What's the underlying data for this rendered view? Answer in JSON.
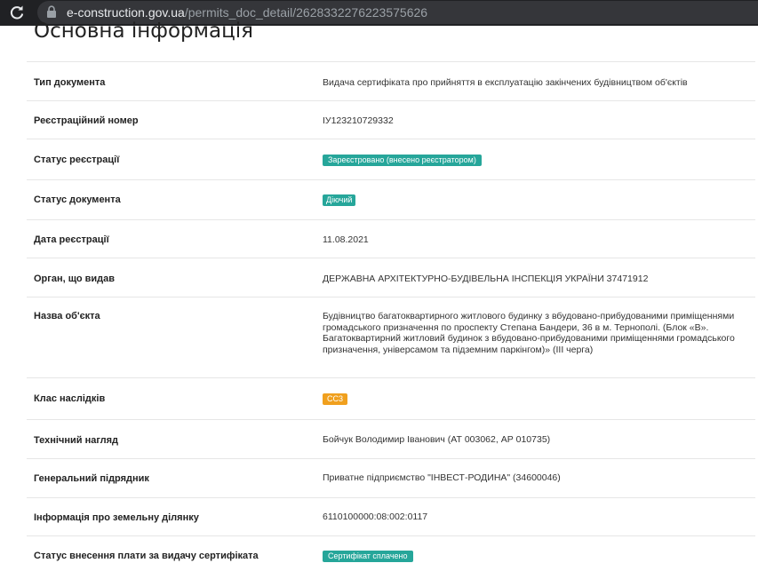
{
  "browser": {
    "url_domain": "e-construction.gov.ua",
    "url_path": "/permits_doc_detail/2628332276223575626"
  },
  "section_title": "Основна інформація",
  "fields": {
    "doc_type": {
      "label": "Тип документа",
      "value": "Видача сертифіката про прийняття в експлуатацію закінчених будівництвом об'єктів"
    },
    "reg_number": {
      "label": "Реєстраційний номер",
      "value": "ІУ123210729332"
    },
    "reg_status": {
      "label": "Статус реєстрації",
      "value": "Зареєстровано (внесено реєстратором)",
      "color": "#26a69a"
    },
    "doc_status": {
      "label": "Статус документа",
      "value": "Діючий",
      "color": "#26a69a"
    },
    "reg_date": {
      "label": "Дата реєстрації",
      "value": "11.08.2021"
    },
    "issuer": {
      "label": "Орган, що видав",
      "value": "ДЕРЖАВНА АРХІТЕКТУРНО-БУДІВЕЛЬНА ІНСПЕКЦІЯ УКРАЇНИ 37471912"
    },
    "object_name": {
      "label": "Назва об'єкта",
      "value": "Будівництво багатоквартирного житлового будинку з вбудовано-прибудованими приміщеннями громадського призначення по проспекту Степана Бандери, 36 в м. Тернополі. (Блок «В». Багатоквартирний житловий будинок з вбудовано-прибудованими приміщеннями громадського призначення, універсамом та підземним паркінгом)» (ІІІ черга)"
    },
    "consequence_class": {
      "label": "Клас наслідків",
      "value": "СС3",
      "color": "#f0a01e"
    },
    "tech_supervision": {
      "label": "Технічний нагляд",
      "value": "Бойчук Володимир Іванович (АТ 003062, АР 010735)"
    },
    "general_contractor": {
      "label": "Генеральний підрядник",
      "value": "Приватне підприємство \"ІНВЕСТ-РОДИНА\" (34600046)"
    },
    "land_info": {
      "label": "Інформація про земельну ділянку",
      "value": "6110100000:08:002:0117"
    },
    "fee_status": {
      "label": "Статус внесення плати за видачу сертифіката",
      "value": "Сертифікат сплачено",
      "color": "#26a69a"
    }
  }
}
